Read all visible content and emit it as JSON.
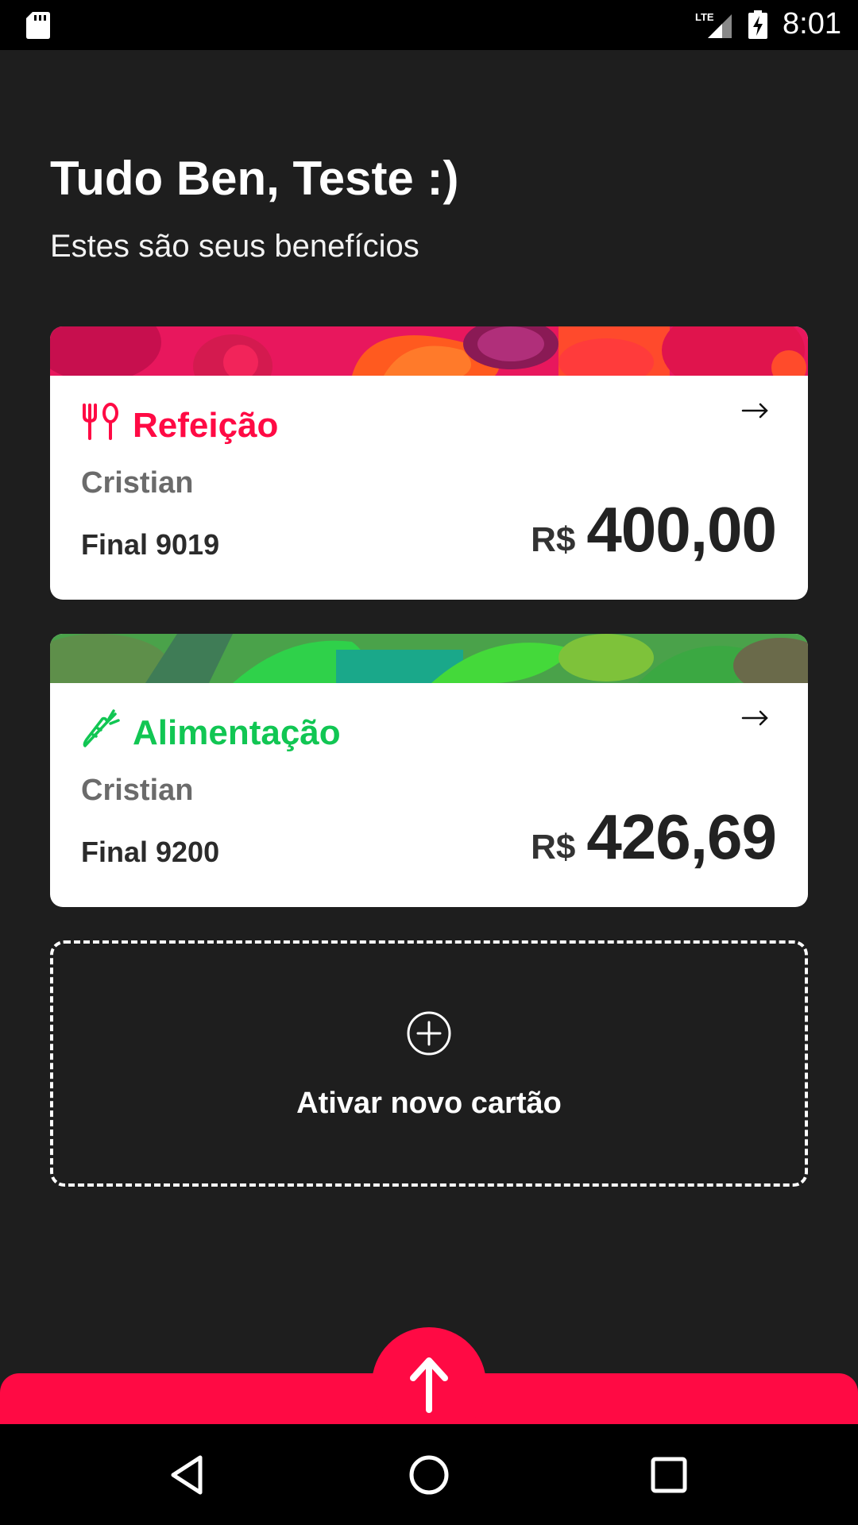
{
  "status_bar": {
    "time": "8:01",
    "network_label": "LTE"
  },
  "greeting": {
    "title": "Tudo Ben, Teste :)",
    "subtitle": "Estes são seus benefícios"
  },
  "cards": [
    {
      "type": "Refeição",
      "type_color": "#ff0a44",
      "icon": "fork-knife-icon",
      "holder": "Cristian",
      "final": "Final 9019",
      "currency": "R$",
      "amount": "400,00"
    },
    {
      "type": "Alimentação",
      "type_color": "#11c653",
      "icon": "carrot-icon",
      "holder": "Cristian",
      "final": "Final 9200",
      "currency": "R$",
      "amount": "426,69"
    }
  ],
  "activate": {
    "label": "Ativar novo cartão",
    "icon": "plus-circle-icon"
  },
  "bottom_bar": {
    "accent": "#ff0a44",
    "fab_icon": "arrow-up-icon"
  },
  "nav": {
    "back_icon": "back-triangle-icon",
    "home_icon": "home-circle-icon",
    "recents_icon": "recents-square-icon"
  }
}
